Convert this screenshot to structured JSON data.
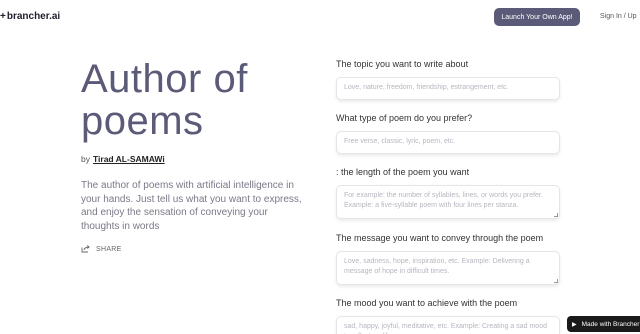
{
  "header": {
    "logo_text": "brancher.ai",
    "logo_mark": "+",
    "launch_label": "Launch Your Own App!",
    "signin_label": "Sign In / Up"
  },
  "hero": {
    "title": "Author of poems",
    "by_label": "by",
    "author": "Tirad AL-SAMAWi",
    "description": "The author of poems with artificial intelligence in your hands. Just tell us what you want to express, and enjoy the sensation of conveying your thoughts in words",
    "share_label": "SHARE"
  },
  "form": {
    "fields": [
      {
        "label": "The topic you want to write about",
        "placeholder": "Love, nature, freedom, friendship, estrangement, etc."
      },
      {
        "label": "What type of poem do you prefer?",
        "placeholder": "Free verse, classic, lyric, poem, etc."
      },
      {
        "label": ": the length of the poem you want",
        "placeholder": "For example: the number of syllables, lines, or words you prefer. Example: a five-syllable poem with four lines per stanza."
      },
      {
        "label": "The message you want to convey through the poem",
        "placeholder": "Love, sadness, hope, inspiration, etc. Example: Delivering a message of hope in difficult times."
      },
      {
        "label": "The mood you want to achieve with the poem",
        "placeholder": "sad, happy, joyful, meditative, etc. Example: Creating a sad mood to reflect on life"
      }
    ]
  },
  "badge": {
    "label": "Made with Brancher"
  }
}
